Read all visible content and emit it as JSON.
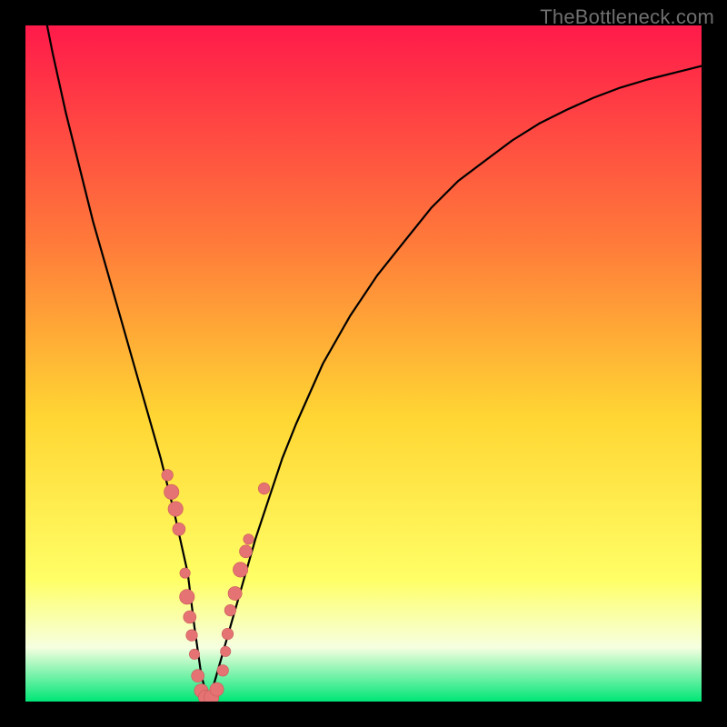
{
  "watermark": "TheBottleneck.com",
  "colors": {
    "frame": "#000000",
    "gradient_top": "#ff1a4a",
    "gradient_mid1": "#ff7a3a",
    "gradient_mid2": "#ffd633",
    "gradient_mid3": "#ffff66",
    "gradient_bottom_band": "#f6ffe0",
    "gradient_bottom": "#00e676",
    "curve": "#000000",
    "marker_fill": "#e57373",
    "marker_stroke": "#c85a5a"
  },
  "chart_data": {
    "type": "line",
    "title": "",
    "xlabel": "",
    "ylabel": "",
    "xlim": [
      0,
      100
    ],
    "ylim": [
      0,
      100
    ],
    "grid": false,
    "curve": {
      "name": "bottleneck-v-curve",
      "x": [
        0,
        2,
        4,
        6,
        8,
        10,
        12,
        14,
        16,
        18,
        20,
        22,
        24,
        25,
        26,
        27,
        28,
        30,
        32,
        34,
        36,
        38,
        40,
        44,
        48,
        52,
        56,
        60,
        64,
        68,
        72,
        76,
        80,
        84,
        88,
        92,
        96,
        100
      ],
      "y": [
        118,
        106,
        96,
        87,
        79,
        71,
        64,
        57,
        50,
        43,
        36,
        28,
        19,
        11,
        4,
        0,
        3,
        10,
        17,
        24,
        30,
        36,
        41,
        50,
        57,
        63,
        68,
        73,
        77,
        80,
        83,
        85.5,
        87.5,
        89.3,
        90.8,
        92,
        93,
        94
      ]
    },
    "markers": {
      "name": "highlighted-points",
      "points": [
        {
          "x": 21.0,
          "y": 33.5,
          "r": 1.0
        },
        {
          "x": 21.6,
          "y": 31.0,
          "r": 1.3
        },
        {
          "x": 22.2,
          "y": 28.5,
          "r": 1.3
        },
        {
          "x": 22.7,
          "y": 25.5,
          "r": 1.1
        },
        {
          "x": 23.6,
          "y": 19.0,
          "r": 0.9
        },
        {
          "x": 23.9,
          "y": 15.5,
          "r": 1.3
        },
        {
          "x": 24.3,
          "y": 12.5,
          "r": 1.1
        },
        {
          "x": 24.6,
          "y": 9.8,
          "r": 1.0
        },
        {
          "x": 25.0,
          "y": 7.0,
          "r": 0.9
        },
        {
          "x": 25.5,
          "y": 3.8,
          "r": 1.1
        },
        {
          "x": 26.0,
          "y": 1.6,
          "r": 1.2
        },
        {
          "x": 26.7,
          "y": 0.6,
          "r": 1.3
        },
        {
          "x": 27.5,
          "y": 0.6,
          "r": 1.3
        },
        {
          "x": 28.3,
          "y": 1.8,
          "r": 1.2
        },
        {
          "x": 29.2,
          "y": 4.6,
          "r": 1.0
        },
        {
          "x": 29.6,
          "y": 7.4,
          "r": 0.9
        },
        {
          "x": 29.9,
          "y": 10.0,
          "r": 1.0
        },
        {
          "x": 30.3,
          "y": 13.5,
          "r": 1.0
        },
        {
          "x": 31.0,
          "y": 16.0,
          "r": 1.2
        },
        {
          "x": 31.8,
          "y": 19.5,
          "r": 1.3
        },
        {
          "x": 32.6,
          "y": 22.2,
          "r": 1.1
        },
        {
          "x": 33.0,
          "y": 24.0,
          "r": 0.9
        },
        {
          "x": 35.3,
          "y": 31.5,
          "r": 1.0
        }
      ]
    }
  }
}
